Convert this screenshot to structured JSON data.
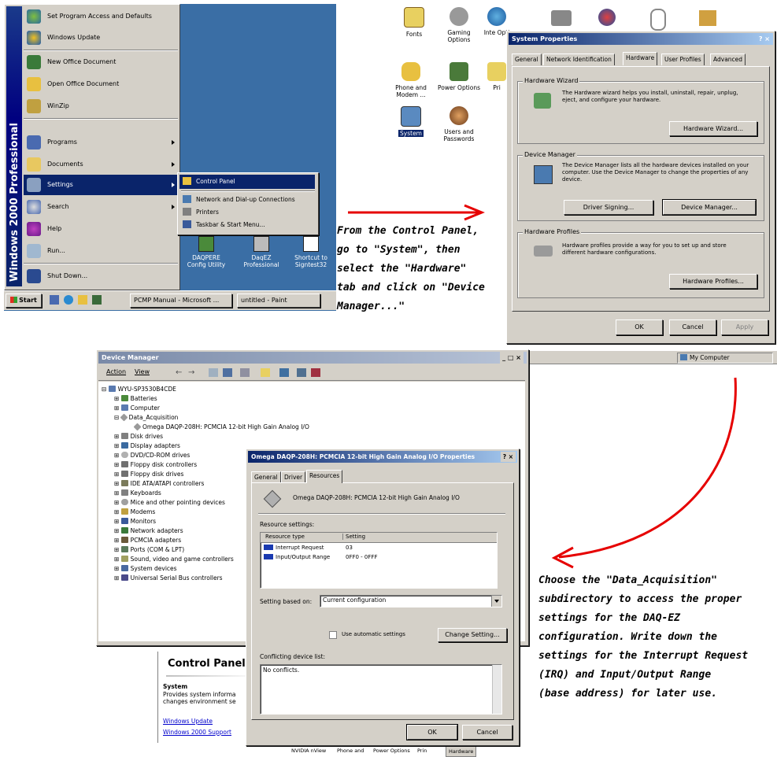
{
  "start_menu": {
    "side_banner": "Windows 2000 Professional",
    "items": [
      {
        "label": "Set Program Access and Defaults",
        "icon": "program-access-icon"
      },
      {
        "label": "Windows Update",
        "icon": "windows-update-icon"
      },
      {
        "label": "New Office Document",
        "icon": "new-office-document-icon"
      },
      {
        "label": "Open Office Document",
        "icon": "open-office-document-icon"
      },
      {
        "label": "WinZip",
        "icon": "winzip-icon"
      },
      {
        "label": "Programs",
        "icon": "programs-icon"
      },
      {
        "label": "Documents",
        "icon": "documents-icon"
      },
      {
        "label": "Settings",
        "icon": "settings-icon"
      },
      {
        "label": "Search",
        "icon": "search-icon"
      },
      {
        "label": "Help",
        "icon": "help-icon"
      },
      {
        "label": "Run...",
        "icon": "run-icon"
      },
      {
        "label": "Shut Down...",
        "icon": "shutdown-icon"
      }
    ],
    "settings_submenu": [
      "Control Panel",
      "Network and Dial-up Connections",
      "Printers",
      "Taskbar & Start Menu..."
    ]
  },
  "desktop_icons": [
    "DAQPERE Config Utility",
    "DaqEZ Professional",
    "Shortcut to Signtest32"
  ],
  "taskbar": {
    "start_label": "Start",
    "tasks": [
      "PCMP Manual - Microsoft ...",
      "untitled - Paint"
    ]
  },
  "control_panel_icons": [
    "Fonts",
    "Gaming Options",
    "Inte Opti",
    "Phone and Modem ...",
    "Power Options",
    "Pri",
    "System",
    "Users and Passwords"
  ],
  "system_properties": {
    "title": "System Properties",
    "title_buttons": "? ×",
    "tabs": [
      "General",
      "Network Identification",
      "Hardware",
      "User Profiles",
      "Advanced"
    ],
    "hardware_wizard": {
      "group": "Hardware Wizard",
      "text": "The Hardware wizard helps you install, uninstall, repair, unplug, eject, and configure your hardware.",
      "button": "Hardware Wizard..."
    },
    "device_manager": {
      "group": "Device Manager",
      "text": "The Device Manager lists all the hardware devices installed on your computer. Use the Device Manager to change the properties of any device.",
      "driver_button": "Driver Signing...",
      "dm_button": "Device Manager..."
    },
    "hardware_profiles": {
      "group": "Hardware Profiles",
      "text": "Hardware profiles provide a way for you to set up and store different hardware configurations.",
      "button": "Hardware Profiles..."
    },
    "ok": "OK",
    "cancel": "Cancel",
    "apply": "Apply"
  },
  "my_computer_label": "My Computer",
  "caption1": [
    "From the Control Panel,",
    "go to \"System\", then",
    "select the \"Hardware\"",
    "tab and click on \"Device",
    "Manager...\""
  ],
  "device_manager": {
    "title": "Device Manager",
    "title_buttons": "_ □ ×",
    "menu": [
      "Action",
      "View"
    ],
    "root": "WYU-SP3530B4CDE",
    "nodes": [
      "Batteries",
      "Computer",
      "Data_Acquisition",
      "Omega DAQP-208H: PCMCIA 12-bit High Gain Analog I/O",
      "Disk drives",
      "Display adapters",
      "DVD/CD-ROM drives",
      "Floppy disk controllers",
      "Floppy disk drives",
      "IDE ATA/ATAPI controllers",
      "Keyboards",
      "Mice and other pointing devices",
      "Modems",
      "Monitors",
      "Network adapters",
      "PCMCIA adapters",
      "Ports (COM & LPT)",
      "Sound, video and game controllers",
      "System devices",
      "Universal Serial Bus controllers"
    ]
  },
  "control_panel_fragment": {
    "title": "Control Panel",
    "heading": "System",
    "desc": "Provides system informa changes environment se",
    "links": [
      "Windows Update",
      "Windows 2000 Support"
    ],
    "status_items": [
      "NVIDIA nView",
      "Phone and",
      "Power Options",
      "Prin",
      "Hardware"
    ]
  },
  "device_props": {
    "title": "Omega DAQP-208H: PCMCIA 12-bit High Gain Analog I/O Properties",
    "title_buttons": "? ×",
    "tabs": [
      "General",
      "Driver",
      "Resources"
    ],
    "device_name": "Omega DAQP-208H: PCMCIA 12-bit High Gain Analog I/O",
    "resource_settings_label": "Resource settings:",
    "columns": [
      "Resource type",
      "Setting"
    ],
    "rows": [
      {
        "type": "Interrupt Request",
        "setting": "03"
      },
      {
        "type": "Input/Output Range",
        "setting": "0FF0 - 0FFF"
      }
    ],
    "setting_based_on_label": "Setting based on:",
    "setting_based_on_value": "Current configuration",
    "use_auto_label": "Use automatic settings",
    "change_button": "Change Setting...",
    "conflict_label": "Conflicting device list:",
    "conflict_text": "No conflicts.",
    "ok": "OK",
    "cancel": "Cancel"
  },
  "caption2": [
    "Choose the \"Data_Acquisition\"",
    "subdirectory to access the proper",
    "settings for the DAQ-EZ",
    "configuration.  Write down the",
    "settings for the Interrupt Request",
    "(IRQ) and Input/Output Range",
    "(base address) for later use."
  ],
  "colors": {
    "arrow": "#e60000",
    "titlebar": "#0a246a",
    "desktop": "#3a6ea5",
    "dialog": "#d4d0c8"
  }
}
